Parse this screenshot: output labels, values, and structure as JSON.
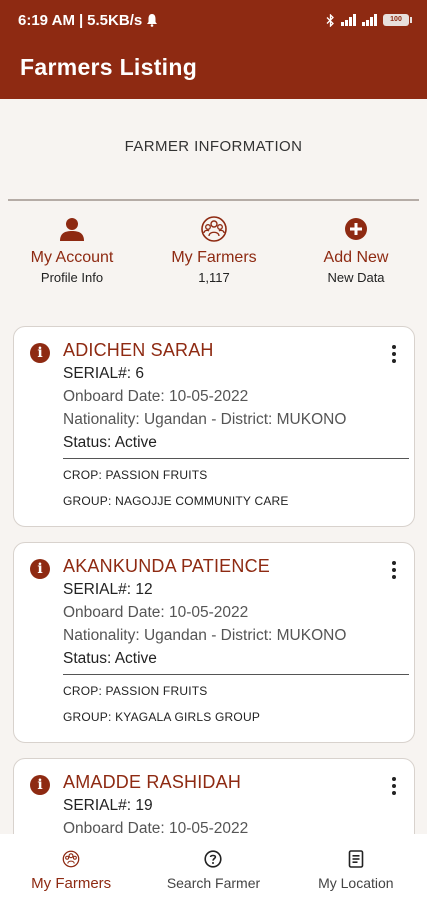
{
  "status_bar": {
    "time": "6:19 AM",
    "speed": "5.5KB/s",
    "battery": "100"
  },
  "app": {
    "title": "Farmers Listing"
  },
  "section": {
    "title": "FARMER INFORMATION"
  },
  "quick_actions": [
    {
      "label": "My Account",
      "sub": "Profile Info",
      "icon": "person-icon"
    },
    {
      "label": "My Farmers",
      "sub": "1,117",
      "icon": "group-icon"
    },
    {
      "label": "Add New",
      "sub": "New Data",
      "icon": "add-circle-icon"
    }
  ],
  "farmers": [
    {
      "name": "ADICHEN SARAH",
      "serial": "SERIAL#: 6",
      "onboard": "Onboard Date: 10-05-2022",
      "nationality": "Nationality: Ugandan - District: MUKONO",
      "status": "Status: Active",
      "crop": "CROP: PASSION FRUITS",
      "group": "GROUP: NAGOJJE COMMUNITY CARE"
    },
    {
      "name": "AKANKUNDA PATIENCE",
      "serial": "SERIAL#: 12",
      "onboard": "Onboard Date: 10-05-2022",
      "nationality": "Nationality: Ugandan - District: MUKONO",
      "status": "Status: Active",
      "crop": "CROP: PASSION FRUITS",
      "group": "GROUP: KYAGALA GIRLS GROUP"
    },
    {
      "name": "AMADDE RASHIDAH",
      "serial": "SERIAL#: 19",
      "onboard": "Onboard Date: 10-05-2022",
      "nationality": "",
      "status": "",
      "crop": "",
      "group": ""
    }
  ],
  "bottom_nav": [
    {
      "label": "My Farmers",
      "icon": "group-icon",
      "active": true
    },
    {
      "label": "Search Farmer",
      "icon": "help-circle-icon",
      "active": false
    },
    {
      "label": "My Location",
      "icon": "receipt-icon",
      "active": false
    }
  ],
  "colors": {
    "primary": "#8e2a12",
    "background": "#f7f4f1"
  }
}
